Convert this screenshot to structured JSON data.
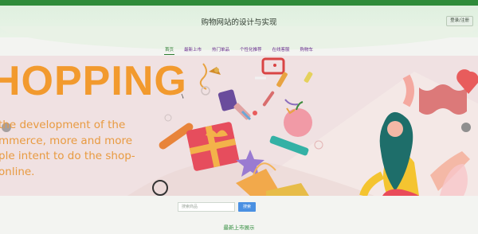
{
  "header": {
    "site_title": "购物网站的设计与实现",
    "login_button": "登录/注册"
  },
  "nav": {
    "items": [
      {
        "label": "首页",
        "active": true
      },
      {
        "label": "最新上市",
        "active": false
      },
      {
        "label": "热门单品",
        "active": false
      },
      {
        "label": "个性化推荐",
        "active": false
      },
      {
        "label": "在线客服",
        "active": false
      },
      {
        "label": "购物车",
        "active": false
      }
    ]
  },
  "banner": {
    "headline": "HOPPING",
    "subtitle": "the development of the mmerce, more and more ple intent to do the shop- online."
  },
  "search": {
    "placeholder": "搜索商品",
    "button_label": "搜索"
  },
  "section": {
    "title": "最新上市展示"
  },
  "colors": {
    "brand_green": "#2e8b3a",
    "nav_text": "#6a2e8f",
    "banner_bg": "#f0e1e2",
    "headline_orange": "#f29a2e",
    "search_button": "#4a90e2"
  }
}
